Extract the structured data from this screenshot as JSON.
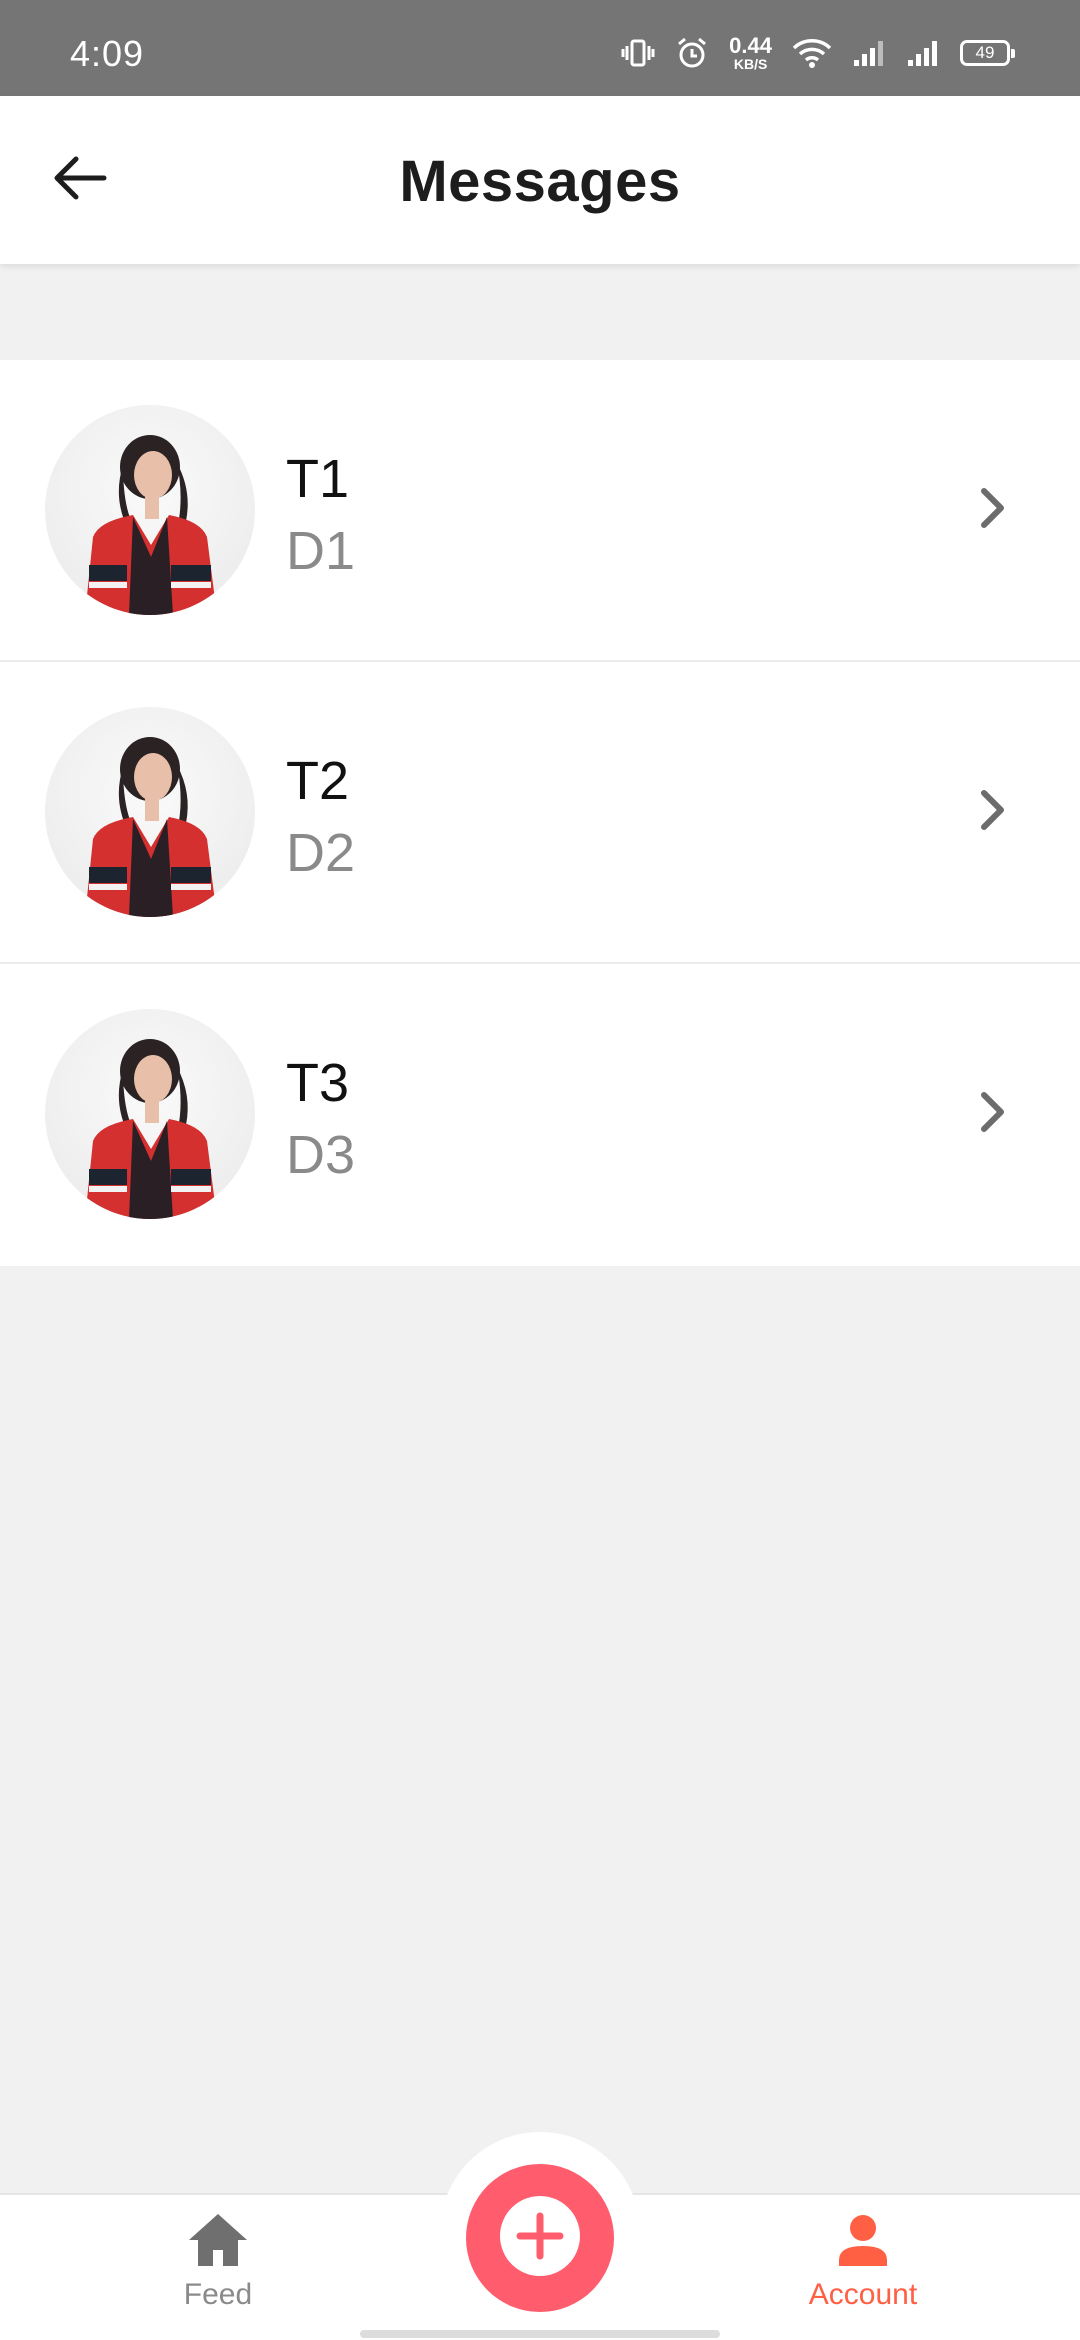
{
  "status_bar": {
    "time": "4:09",
    "net_speed_value": "0.44",
    "net_speed_unit": "KB/S",
    "battery": "49"
  },
  "app_bar": {
    "title": "Messages",
    "back_icon": "arrow-left-icon"
  },
  "messages": [
    {
      "title": "T1",
      "description": "D1"
    },
    {
      "title": "T2",
      "description": "D2"
    },
    {
      "title": "T3",
      "description": "D3"
    }
  ],
  "bottom_nav": {
    "feed_label": "Feed",
    "account_label": "Account",
    "feed_icon": "home-icon",
    "fab_icon": "plus-icon",
    "account_icon": "person-icon"
  },
  "colors": {
    "status_bar": "#757575",
    "fab": "#ff5c6d",
    "accent": "#ff5f43",
    "inactive": "#8a8a8a"
  }
}
